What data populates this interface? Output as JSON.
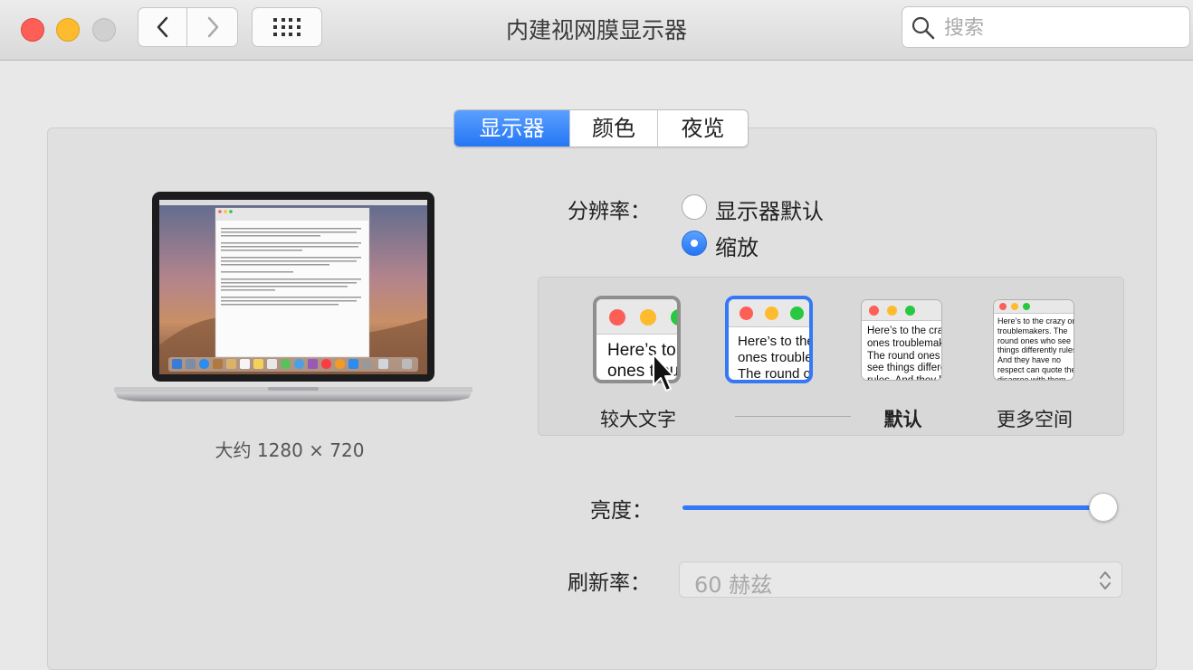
{
  "window": {
    "title": "内建视网膜显示器"
  },
  "toolbar": {
    "search_placeholder": "搜索"
  },
  "tabs": [
    {
      "label": "显示器",
      "active": true
    },
    {
      "label": "颜色",
      "active": false
    },
    {
      "label": "夜览",
      "active": false
    }
  ],
  "laptop": {
    "caption": "大约 1280 × 720"
  },
  "resolution": {
    "label": "分辨率：",
    "options": [
      {
        "label": "显示器默认",
        "selected": false
      },
      {
        "label": "缩放",
        "selected": true
      }
    ]
  },
  "scaling": {
    "sample_text": "Here’s to the crazy ones troublemakers. The round ones who see things differently rules. And they have no respect can quote them, disagree with them. About the only thing Because they change things.",
    "options": [
      {
        "label": "较大文字",
        "selected": false
      },
      {
        "label": "",
        "selected": true
      },
      {
        "label": "默认",
        "selected": false
      },
      {
        "label": "更多空间",
        "selected": false
      }
    ]
  },
  "brightness": {
    "label": "亮度：",
    "value_percent": 100
  },
  "refresh": {
    "label": "刷新率：",
    "value": "60 赫兹"
  },
  "colors": {
    "accent": "#3478f6",
    "red": "#fd5f57",
    "yellow": "#febb2e",
    "green": "#28c840"
  }
}
